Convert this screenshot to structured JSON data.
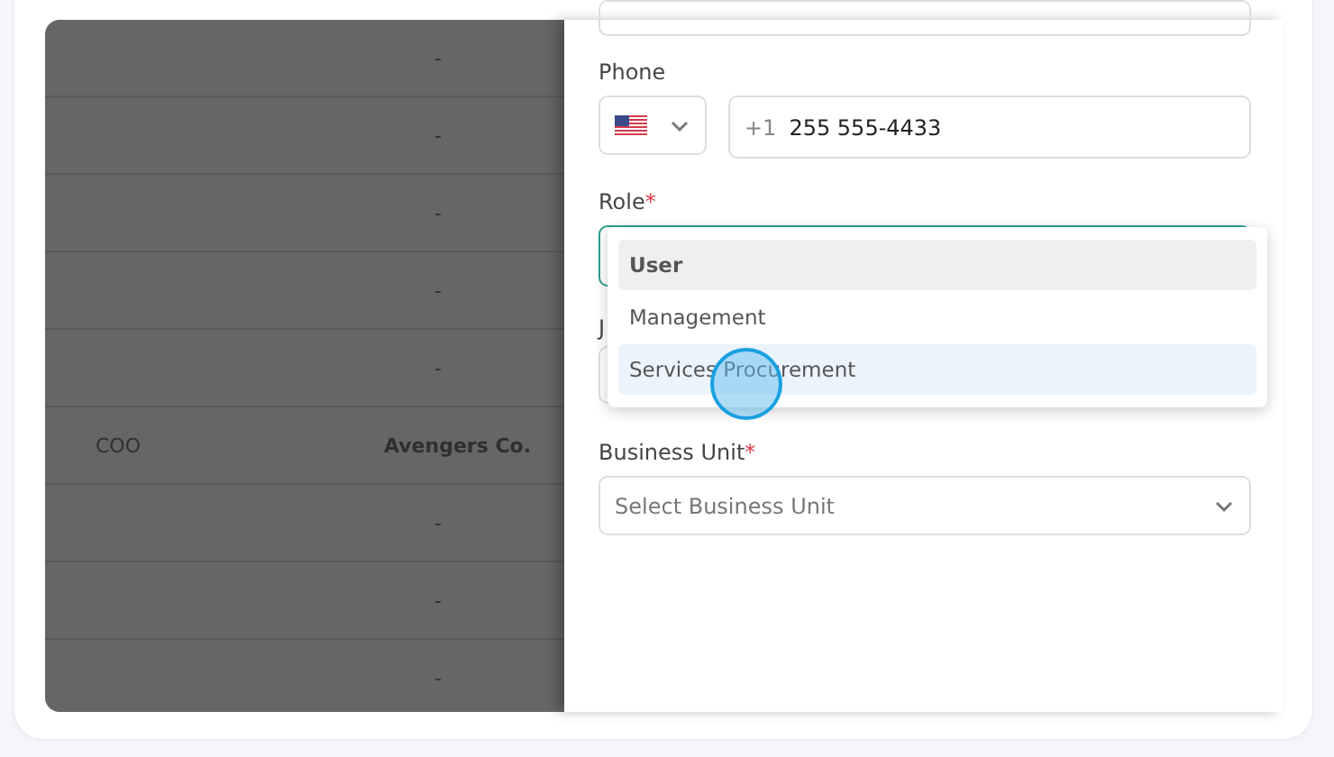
{
  "table": {
    "rows": [
      {
        "column_1": "",
        "column_2": "-"
      },
      {
        "column_1": "",
        "column_2": "-"
      },
      {
        "column_1": "",
        "column_2": "-"
      },
      {
        "column_1": "",
        "column_2": "-"
      },
      {
        "column_1": "",
        "column_2": "-"
      },
      {
        "column_1": "COO",
        "column_2": "Avengers Co."
      },
      {
        "column_1": "",
        "column_2": "-"
      },
      {
        "column_1": "",
        "column_2": "-"
      },
      {
        "column_1": "",
        "column_2": "-"
      }
    ]
  },
  "form": {
    "required_mark": "*",
    "phone": {
      "label": "Phone",
      "prefix": "+1",
      "value": "255 555-4433"
    },
    "role": {
      "label": "Role",
      "required": true,
      "options": [
        {
          "label": "User",
          "selected": true,
          "hovered": false
        },
        {
          "label": "Management",
          "selected": false,
          "hovered": false
        },
        {
          "label": "Services Procurement",
          "selected": false,
          "hovered": true
        }
      ]
    },
    "hidden_label": "J",
    "business_unit": {
      "label": "Business Unit",
      "required": true,
      "placeholder": "Select Business Unit"
    }
  }
}
